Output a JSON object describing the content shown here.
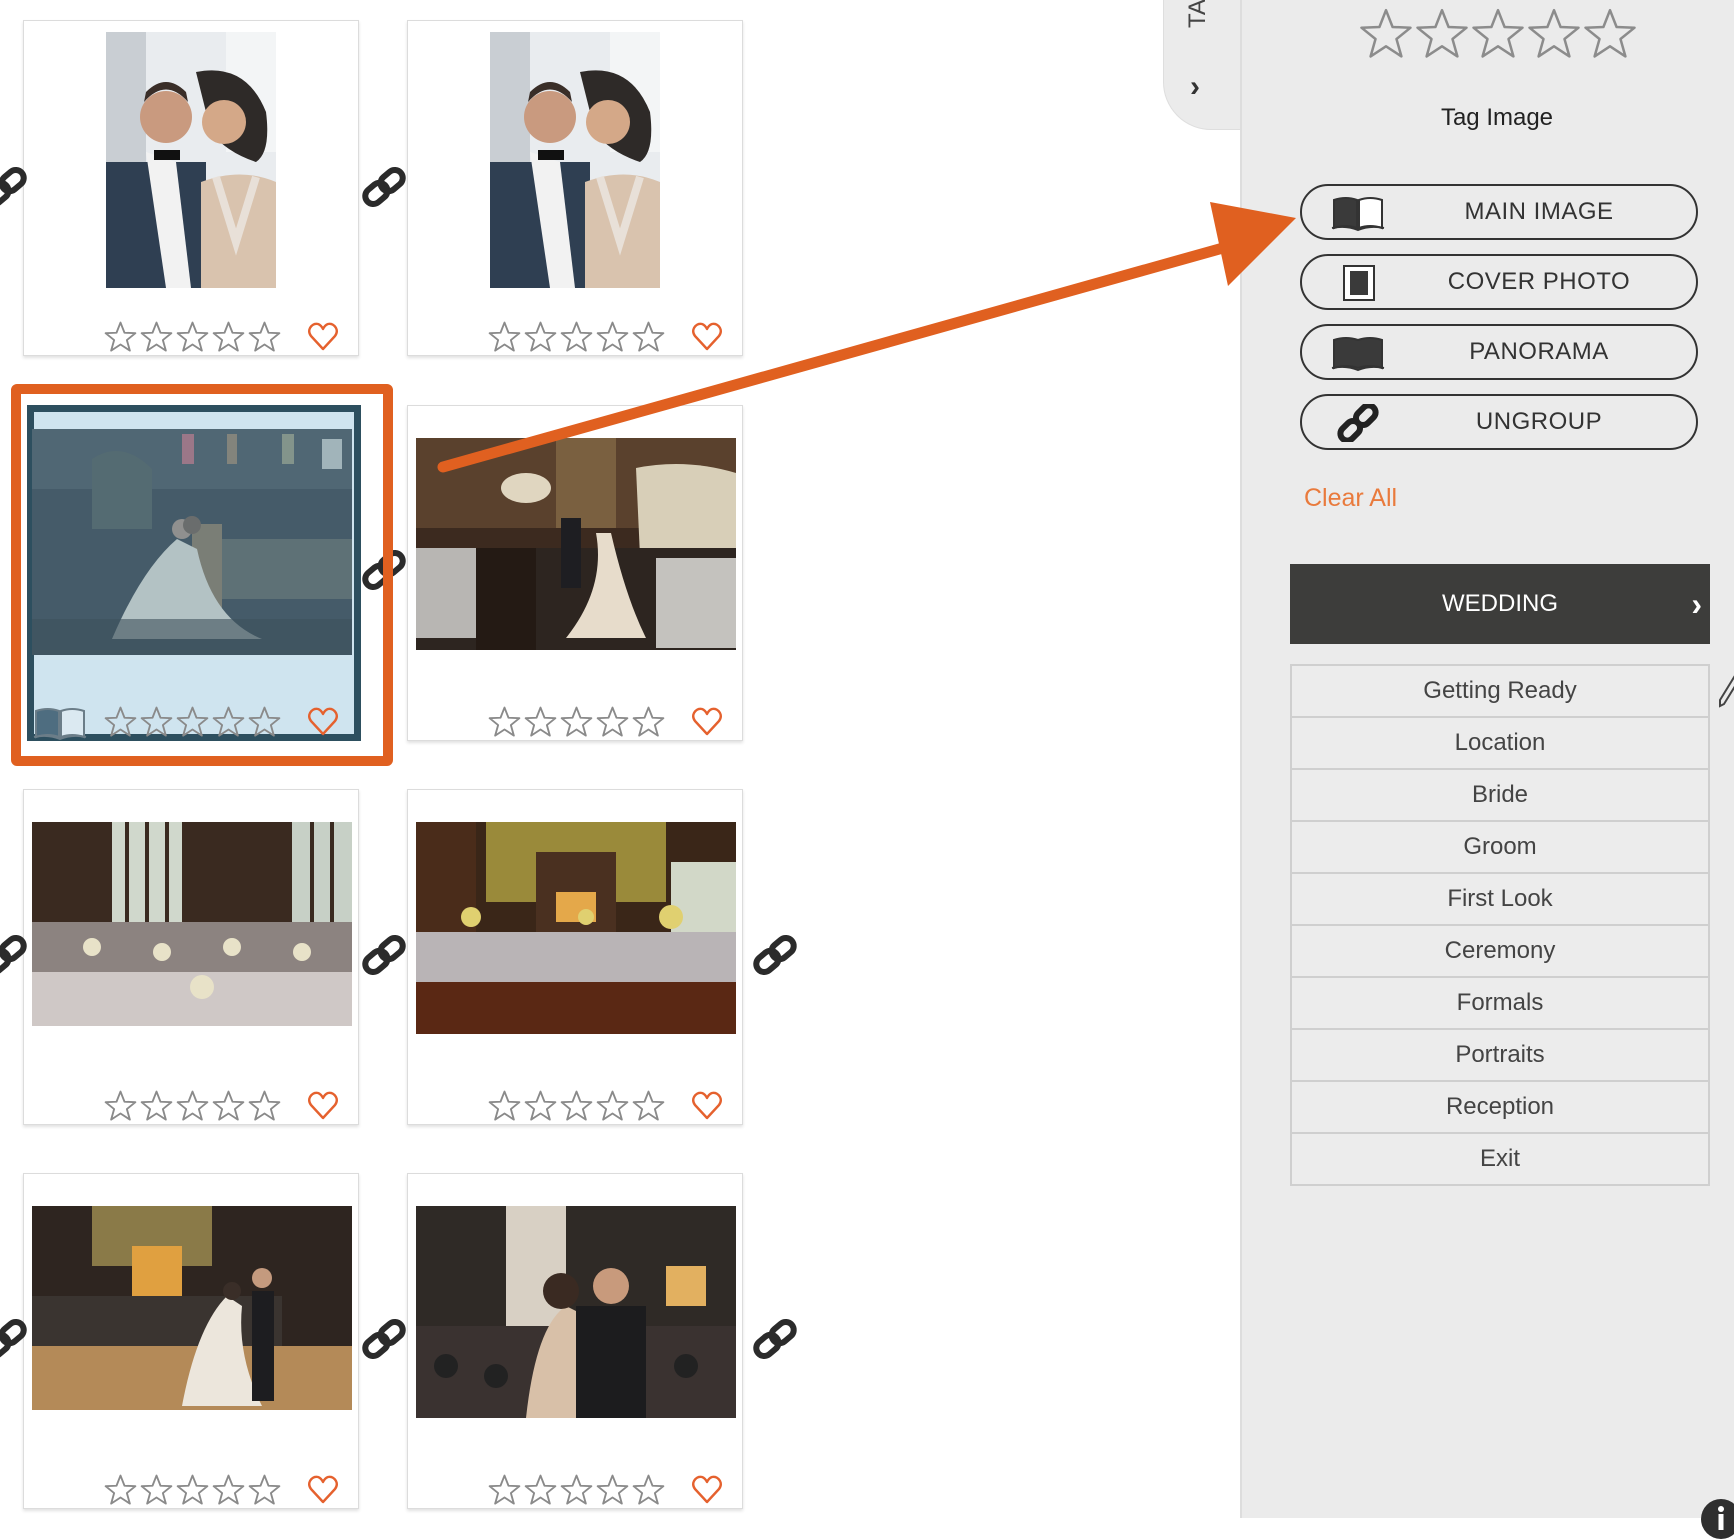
{
  "gallery": {
    "cards": [
      {
        "id": "card-1",
        "orientation": "portrait",
        "scene": "couple-portrait-window",
        "rating": 0,
        "favorite": false,
        "selected": false,
        "tag": null
      },
      {
        "id": "card-2",
        "orientation": "portrait",
        "scene": "couple-portrait-window",
        "rating": 0,
        "favorite": false,
        "selected": false,
        "tag": null
      },
      {
        "id": "card-3",
        "orientation": "landscape",
        "scene": "couple-church-interior",
        "rating": 0,
        "favorite": false,
        "selected": true,
        "tag": "main-image"
      },
      {
        "id": "card-4",
        "orientation": "landscape",
        "scene": "couple-dining-hall",
        "rating": 0,
        "favorite": false,
        "selected": false,
        "tag": null
      },
      {
        "id": "card-5",
        "orientation": "landscape",
        "scene": "reception-tables-windows",
        "rating": 0,
        "favorite": false,
        "selected": false,
        "tag": null
      },
      {
        "id": "card-6",
        "orientation": "landscape",
        "scene": "reception-hall-wood",
        "rating": 0,
        "favorite": false,
        "selected": false,
        "tag": null
      },
      {
        "id": "card-7",
        "orientation": "landscape",
        "scene": "first-dance",
        "rating": 0,
        "favorite": false,
        "selected": false,
        "tag": null
      },
      {
        "id": "card-8",
        "orientation": "landscape",
        "scene": "couple-embrace-reception",
        "rating": 0,
        "favorite": false,
        "selected": false,
        "tag": null
      }
    ],
    "max_rating": 5,
    "icons": {
      "link": "link-icon",
      "star": "star-outline-icon",
      "heart": "heart-outline-icon",
      "book": "open-book-icon"
    }
  },
  "annotation": {
    "color": "#e06020",
    "description": "arrow from selected image to Main Image button"
  },
  "panel": {
    "tab_label": "TA",
    "tab_chevron": "›",
    "rating": 0,
    "max_rating": 5,
    "title": "Tag Image",
    "tag_buttons": [
      {
        "label": "MAIN IMAGE",
        "icon": "open-book-half-icon",
        "active": true
      },
      {
        "label": "COVER PHOTO",
        "icon": "cover-photo-icon",
        "active": false
      },
      {
        "label": "PANORAMA",
        "icon": "panorama-book-icon",
        "active": false
      },
      {
        "label": "UNGROUP",
        "icon": "link-icon",
        "active": false
      }
    ],
    "clear_all": "Clear All",
    "category_header": "WEDDING",
    "category_chevron": "›",
    "categories": [
      "Getting Ready",
      "Location",
      "Bride",
      "Groom",
      "First Look",
      "Ceremony",
      "Formals",
      "Portraits",
      "Reception",
      "Exit"
    ]
  },
  "colors": {
    "accent": "#e06020",
    "active_button": "#6cb2ce",
    "selected_card": "#cfe4ef",
    "selected_border": "#2d4f5f",
    "heart": "#e5612e",
    "header_bar": "#3d3d3b",
    "panel_bg": "#ebebeb",
    "clear_all": "#e97a3c"
  }
}
